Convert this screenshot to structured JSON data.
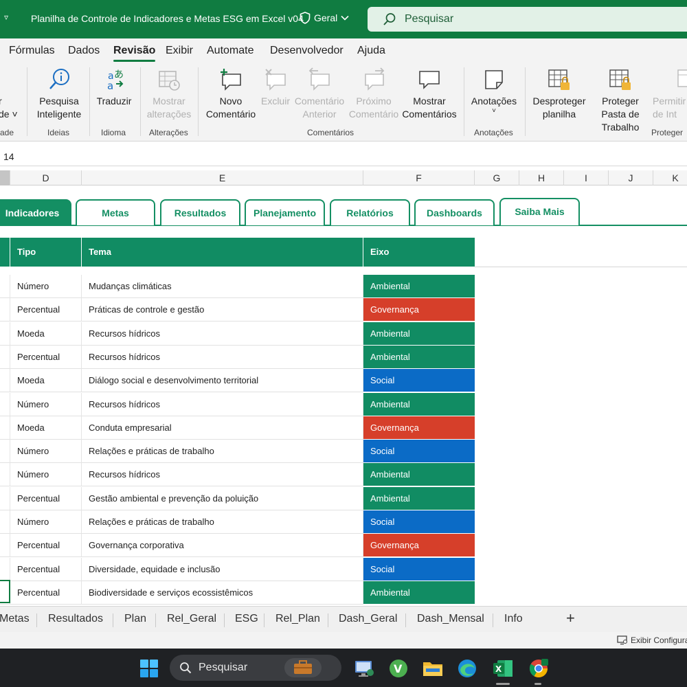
{
  "titlebar": {
    "document_title": "Planilha de Controle de Indicadores e Metas ESG em Excel v04",
    "sensitivity_label": "Geral",
    "search_placeholder": "Pesquisar"
  },
  "menu": {
    "tabs": [
      "Fórmulas",
      "Dados",
      "Revisão",
      "Exibir",
      "Automate",
      "Desenvolvedor",
      "Ajuda"
    ],
    "active": "Revisão"
  },
  "ribbon": {
    "partial_left": {
      "line1": "r",
      "line2": "de ˅",
      "group": "ade"
    },
    "buttons": {
      "pesquisa": "Pesquisa Inteligente",
      "traduzir": "Traduzir",
      "mostrar_alteracoes": "Mostrar alterações",
      "novo_comentario": "Novo Comentário",
      "excluir": "Excluir",
      "comentario_anterior": "Comentário Anterior",
      "proximo_comentario": "Próximo Comentário",
      "mostrar_comentarios": "Mostrar Comentários",
      "anotacoes": "Anotações",
      "desproteger": "Desproteger planilha",
      "proteger_pasta": "Proteger Pasta de Trabalho",
      "permitir": "Permitir de Int"
    },
    "groups": {
      "ideias": "Ideias",
      "idioma": "Idioma",
      "alteracoes": "Alterações",
      "comentarios": "Comentários",
      "anotacoes": "Anotações",
      "proteger": "Proteger"
    }
  },
  "formula_bar": {
    "value": "14"
  },
  "columns": [
    "D",
    "E",
    "F",
    "G",
    "H",
    "I",
    "J",
    "K"
  ],
  "nav_tabs": [
    "Indicadores",
    "Metas",
    "Resultados",
    "Planejamento",
    "Relatórios",
    "Dashboards",
    "Saiba Mais"
  ],
  "table": {
    "headers": {
      "tipo": "Tipo",
      "tema": "Tema",
      "eixo": "Eixo"
    },
    "rows": [
      {
        "tipo": "Número",
        "tema": "Mudanças climáticas",
        "eixo": "Ambiental"
      },
      {
        "tipo": "Percentual",
        "tema": "Práticas de controle e gestão",
        "eixo": "Governança"
      },
      {
        "tipo": "Moeda",
        "tema": "Recursos hídricos",
        "eixo": "Ambiental"
      },
      {
        "tipo": "Percentual",
        "tema": "Recursos hídricos",
        "eixo": "Ambiental"
      },
      {
        "tipo": "Moeda",
        "tema": "Diálogo social e desenvolvimento territorial",
        "eixo": "Social"
      },
      {
        "tipo": "Número",
        "tema": "Recursos hídricos",
        "eixo": "Ambiental"
      },
      {
        "tipo": "Moeda",
        "tema": "Conduta empresarial",
        "eixo": "Governança"
      },
      {
        "tipo": "Número",
        "tema": "Relações e práticas de trabalho",
        "eixo": "Social"
      },
      {
        "tipo": "Número",
        "tema": "Recursos hídricos",
        "eixo": "Ambiental"
      },
      {
        "tipo": "Percentual",
        "tema": "Gestão ambiental e prevenção da poluição",
        "eixo": "Ambiental"
      },
      {
        "tipo": "Número",
        "tema": "Relações e práticas de trabalho",
        "eixo": "Social"
      },
      {
        "tipo": "Percentual",
        "tema": "Governança corporativa",
        "eixo": "Governança"
      },
      {
        "tipo": "Percentual",
        "tema": "Diversidade, equidade e inclusão",
        "eixo": "Social"
      },
      {
        "tipo": "Percentual",
        "tema": "Biodiversidade e serviços ecossistêmicos",
        "eixo": "Ambiental"
      }
    ]
  },
  "eixo_colors": {
    "Ambiental": "#118c63",
    "Governança": "#d63f2a",
    "Social": "#0b6bc6"
  },
  "sheet_tabs": [
    "Metas",
    "Resultados",
    "Plan",
    "Rel_Geral",
    "ESG",
    "Rel_Plan",
    "Dash_Geral",
    "Dash_Mensal",
    "Info"
  ],
  "status": {
    "display_settings": "Exibir Configura"
  },
  "taskbar": {
    "search_placeholder": "Pesquisar",
    "apps": [
      "start-icon",
      "briefcase-icon",
      "remote-desktop-icon",
      "vectorworks-icon",
      "file-explorer-icon",
      "edge-icon",
      "excel-icon",
      "chrome-icon"
    ]
  }
}
